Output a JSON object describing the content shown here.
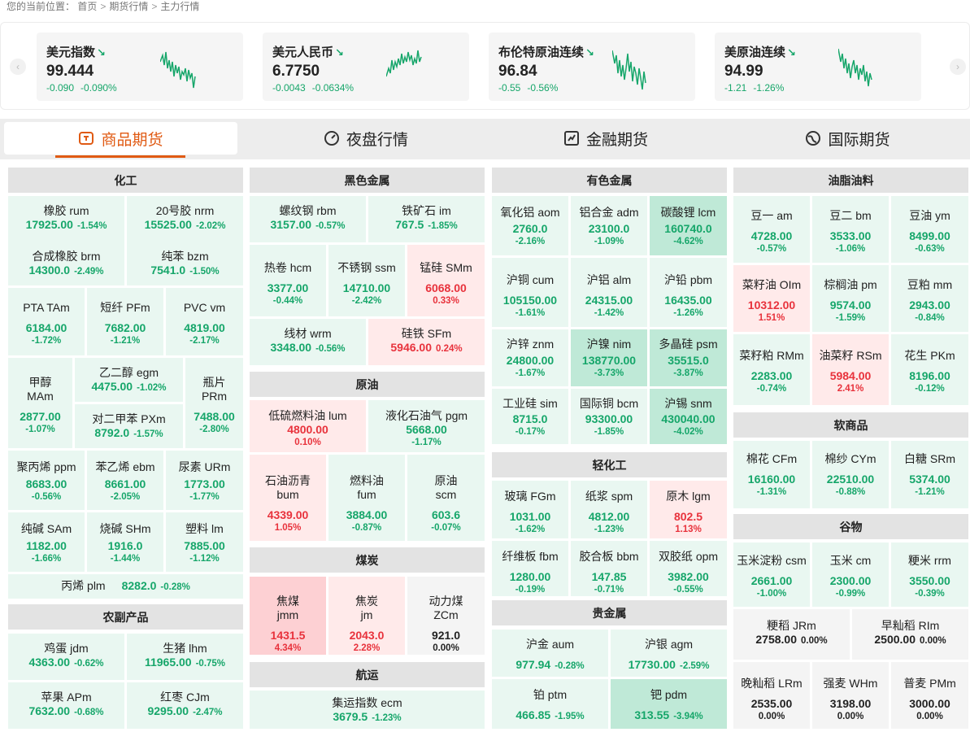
{
  "breadcrumb": {
    "prefix": "您的当前位置：",
    "home": "首页",
    "futures": "期货行情",
    "current": "主力行情",
    "sep": ">"
  },
  "indices": [
    {
      "name": "美元指数",
      "price": "99.444",
      "change": "-0.090",
      "pct": "-0.090%"
    },
    {
      "name": "美元人民币",
      "price": "6.7750",
      "change": "-0.0043",
      "pct": "-0.0634%"
    },
    {
      "name": "布伦特原油连续",
      "price": "96.84",
      "change": "-0.55",
      "pct": "-0.56%"
    },
    {
      "name": "美原油连续",
      "price": "94.99",
      "change": "-1.21",
      "pct": "-1.26%"
    }
  ],
  "nav": {
    "prev": "‹",
    "next": "›"
  },
  "tabs": [
    {
      "label": "商品期货",
      "icon": "commodity-cart-icon",
      "active": true
    },
    {
      "label": "夜盘行情",
      "icon": "gauge-icon",
      "active": false
    },
    {
      "label": "金融期货",
      "icon": "chart-doc-icon",
      "active": false
    },
    {
      "label": "国际期货",
      "icon": "globe-icon",
      "active": false
    }
  ],
  "colors": {
    "up": "#e8323c",
    "down": "#16a66a",
    "accent": "#e05a13"
  },
  "sections": {
    "hg": "化工",
    "hs": "黑色金属",
    "ys": "有色金属",
    "yz": "油脂油料",
    "ny": "原油",
    "qhg": "轻化工",
    "rsp": "软商品",
    "mt": "煤炭",
    "gw": "谷物",
    "ncp": "农副产品",
    "gjs": "贵金属",
    "hy": "航运"
  },
  "q": {
    "rum": {
      "n": "橡胶 rum",
      "v": "17925.00",
      "c": "-1.54%"
    },
    "nrm": {
      "n": "20号胶 nrm",
      "v": "15525.00",
      "c": "-2.02%"
    },
    "brm": {
      "n": "合成橡胶 brm",
      "v": "14300.0",
      "c": "-2.49%"
    },
    "bzm": {
      "n": "纯苯 bzm",
      "v": "7541.0",
      "c": "-1.50%"
    },
    "tam": {
      "n": "PTA TAm",
      "v": "6184.00",
      "c": "-1.72%"
    },
    "pfm": {
      "n": "短纤 PFm",
      "v": "7682.00",
      "c": "-1.21%"
    },
    "vm": {
      "n": "PVC vm",
      "v": "4819.00",
      "c": "-2.17%"
    },
    "mam": {
      "n1": "甲醇",
      "n2": "MAm",
      "v": "2877.00",
      "c": "-1.07%"
    },
    "egm": {
      "n": "乙二醇 egm",
      "v": "4475.00",
      "c": "-1.02%"
    },
    "pxm": {
      "n": "对二甲苯 PXm",
      "v": "8792.0",
      "c": "-1.57%"
    },
    "prm": {
      "n1": "瓶片",
      "n2": "PRm",
      "v": "7488.00",
      "c": "-2.80%"
    },
    "ppm": {
      "n": "聚丙烯 ppm",
      "v": "8683.00",
      "c": "-0.56%"
    },
    "ebm": {
      "n": "苯乙烯 ebm",
      "v": "8661.00",
      "c": "-2.05%"
    },
    "urm": {
      "n": "尿素 URm",
      "v": "1773.00",
      "c": "-1.77%"
    },
    "sam": {
      "n": "纯碱 SAm",
      "v": "1182.00",
      "c": "-1.66%"
    },
    "shm": {
      "n": "烧碱 SHm",
      "v": "1916.0",
      "c": "-1.44%"
    },
    "lm": {
      "n": "塑料 lm",
      "v": "7885.00",
      "c": "-1.12%"
    },
    "plm": {
      "n": "丙烯 plm",
      "v": "8282.0",
      "c": "-0.28%"
    },
    "jdm": {
      "n": "鸡蛋 jdm",
      "v": "4363.00",
      "c": "-0.62%"
    },
    "lhm": {
      "n": "生猪 lhm",
      "v": "11965.00",
      "c": "-0.75%"
    },
    "apm": {
      "n": "苹果 APm",
      "v": "7632.00",
      "c": "-0.68%"
    },
    "cjm": {
      "n": "红枣 CJm",
      "v": "9295.00",
      "c": "-2.47%"
    },
    "rbm": {
      "n": "螺纹钢 rbm",
      "v": "3157.00",
      "c": "-0.57%"
    },
    "im": {
      "n": "铁矿石 im",
      "v": "767.5",
      "c": "-1.85%"
    },
    "hcm": {
      "n": "热卷 hcm",
      "v": "3377.00",
      "c": "-0.44%"
    },
    "ssm": {
      "n": "不锈钢 ssm",
      "v": "14710.00",
      "c": "-2.42%"
    },
    "smm": {
      "n": "锰硅 SMm",
      "v": "6068.00",
      "c": "0.33%"
    },
    "wrm": {
      "n": "线材 wrm",
      "v": "3348.00",
      "c": "-0.56%"
    },
    "sfm": {
      "n": "硅铁 SFm",
      "v": "5946.00",
      "c": "0.24%"
    },
    "lum": {
      "n": "低硫燃料油 lum",
      "v": "4800.00",
      "c": "0.10%"
    },
    "pgm": {
      "n": "液化石油气 pgm",
      "v": "5668.00",
      "c": "-1.17%"
    },
    "bum": {
      "n1": "石油沥青",
      "n2": "bum",
      "v": "4339.00",
      "c": "1.05%"
    },
    "fum": {
      "n1": "燃料油",
      "n2": "fum",
      "v": "3884.00",
      "c": "-0.87%"
    },
    "scm": {
      "n1": "原油",
      "n2": "scm",
      "v": "603.6",
      "c": "-0.07%"
    },
    "jmm": {
      "n1": "焦煤",
      "n2": "jmm",
      "v": "1431.5",
      "c": "4.34%"
    },
    "jm": {
      "n1": "焦炭",
      "n2": "jm",
      "v": "2043.0",
      "c": "2.28%"
    },
    "zcm": {
      "n1": "动力煤",
      "n2": "ZCm",
      "v": "921.0",
      "c": "0.00%"
    },
    "ecm": {
      "n": "集运指数 ecm",
      "v": "3679.5",
      "c": "-1.23%"
    },
    "aom": {
      "n": "氧化铝 aom",
      "v": "2760.0",
      "c": "-2.16%"
    },
    "adm": {
      "n": "铝合金 adm",
      "v": "23100.0",
      "c": "-1.09%"
    },
    "lcm": {
      "n": "碳酸锂 lcm",
      "v": "160740.0",
      "c": "-4.62%"
    },
    "cum": {
      "n": "沪铜 cum",
      "v": "105150.00",
      "c": "-1.61%"
    },
    "alm": {
      "n": "沪铝 alm",
      "v": "24315.00",
      "c": "-1.42%"
    },
    "pbm": {
      "n": "沪铅 pbm",
      "v": "16435.00",
      "c": "-1.26%"
    },
    "znm": {
      "n": "沪锌 znm",
      "v": "24800.00",
      "c": "-1.67%"
    },
    "nim": {
      "n": "沪镍 nim",
      "v": "138770.00",
      "c": "-3.73%"
    },
    "psm": {
      "n": "多晶硅 psm",
      "v": "35515.0",
      "c": "-3.87%"
    },
    "sim": {
      "n": "工业硅 sim",
      "v": "8715.0",
      "c": "-0.17%"
    },
    "bcm": {
      "n": "国际铜 bcm",
      "v": "93300.00",
      "c": "-1.85%"
    },
    "snm": {
      "n": "沪锡 snm",
      "v": "430040.00",
      "c": "-4.02%"
    },
    "fgm": {
      "n": "玻璃 FGm",
      "v": "1031.00",
      "c": "-1.62%"
    },
    "spm": {
      "n": "纸浆 spm",
      "v": "4812.00",
      "c": "-1.23%"
    },
    "lgm": {
      "n": "原木 lgm",
      "v": "802.5",
      "c": "1.13%"
    },
    "fbm": {
      "n": "纤维板 fbm",
      "v": "1280.00",
      "c": "-0.19%"
    },
    "bbm": {
      "n": "胶合板 bbm",
      "v": "147.85",
      "c": "-0.71%"
    },
    "opm": {
      "n": "双胶纸 opm",
      "v": "3982.00",
      "c": "-0.55%"
    },
    "aum": {
      "n": "沪金 aum",
      "v": "977.94",
      "c": "-0.28%"
    },
    "agm": {
      "n": "沪银 agm",
      "v": "17730.00",
      "c": "-2.59%"
    },
    "ptm": {
      "n": "铂 ptm",
      "v": "466.85",
      "c": "-1.95%"
    },
    "pdm": {
      "n": "钯 pdm",
      "v": "313.55",
      "c": "-3.94%"
    },
    "am": {
      "n": "豆一 am",
      "v": "4728.00",
      "c": "-0.57%"
    },
    "bm": {
      "n": "豆二 bm",
      "v": "3533.00",
      "c": "-1.06%"
    },
    "ym": {
      "n": "豆油 ym",
      "v": "8499.00",
      "c": "-0.63%"
    },
    "oim": {
      "n": "菜籽油 OIm",
      "v": "10312.00",
      "c": "1.51%"
    },
    "pm": {
      "n": "棕榈油 pm",
      "v": "9574.00",
      "c": "-1.59%"
    },
    "mm": {
      "n": "豆粕 mm",
      "v": "2943.00",
      "c": "-0.84%"
    },
    "rmm": {
      "n": "菜籽粕 RMm",
      "v": "2283.00",
      "c": "-0.74%"
    },
    "rsm": {
      "n": "油菜籽 RSm",
      "v": "5984.00",
      "c": "2.41%"
    },
    "pkm": {
      "n": "花生 PKm",
      "v": "8196.00",
      "c": "-0.12%"
    },
    "cfm": {
      "n": "棉花 CFm",
      "v": "16160.00",
      "c": "-1.31%"
    },
    "cym": {
      "n": "棉纱 CYm",
      "v": "22510.00",
      "c": "-0.88%"
    },
    "srm": {
      "n": "白糖 SRm",
      "v": "5374.00",
      "c": "-1.21%"
    },
    "csm": {
      "n": "玉米淀粉 csm",
      "v": "2661.00",
      "c": "-1.00%"
    },
    "cm": {
      "n": "玉米 cm",
      "v": "2300.00",
      "c": "-0.99%"
    },
    "rrm": {
      "n": "粳米 rrm",
      "v": "3550.00",
      "c": "-0.39%"
    },
    "jrm": {
      "n": "粳稻 JRm",
      "v": "2758.00",
      "c": "0.00%"
    },
    "rim": {
      "n": "早籼稻 RIm",
      "v": "2500.00",
      "c": "0.00%"
    },
    "lrm": {
      "n": "晚籼稻 LRm",
      "v": "2535.00",
      "c": "0.00%"
    },
    "whm": {
      "n": "强麦 WHm",
      "v": "3198.00",
      "c": "0.00%"
    },
    "pmm": {
      "n": "普麦 PMm",
      "v": "3000.00",
      "c": "0.00%"
    }
  }
}
